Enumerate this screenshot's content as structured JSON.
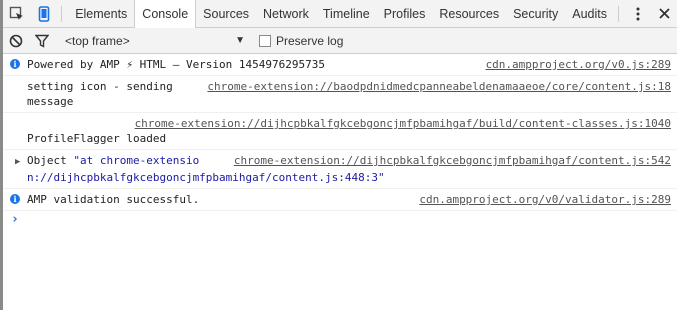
{
  "tabs": [
    "Elements",
    "Console",
    "Sources",
    "Network",
    "Timeline",
    "Profiles",
    "Resources",
    "Security",
    "Audits"
  ],
  "filter": {
    "frame": "<top frame>",
    "preserve_log": "Preserve log"
  },
  "messages": [
    {
      "text": "Powered by AMP ⚡ HTML – Version 1454976295735",
      "source": "cdn.ampproject.org/v0.js:289"
    },
    {
      "text1": "setting icon - sending",
      "text2": "message",
      "source": "chrome-extension://baodpdnidmedcpanneabeldenamaaeoe/core/content.js:18"
    },
    {
      "source": "chrome-extension://dijhcpbkalfgkcebgoncjmfpbamihgaf/build/content-classes.js:1040",
      "text": "ProfileFlagger loaded"
    },
    {
      "obj_prefix": "Object ",
      "obj_str": "\"at chrome-extensio",
      "source": "chrome-extension://dijhcpbkalfgkcebgoncjmfpbamihgaf/content.js:542",
      "obj_cont": "n://dijhcpbkalfgkcebgoncjmfpbamihgaf/content.js:448:3\""
    },
    {
      "text": "AMP validation successful.",
      "source": "cdn.ampproject.org/v0/validator.js:289"
    }
  ],
  "prompt": "›"
}
